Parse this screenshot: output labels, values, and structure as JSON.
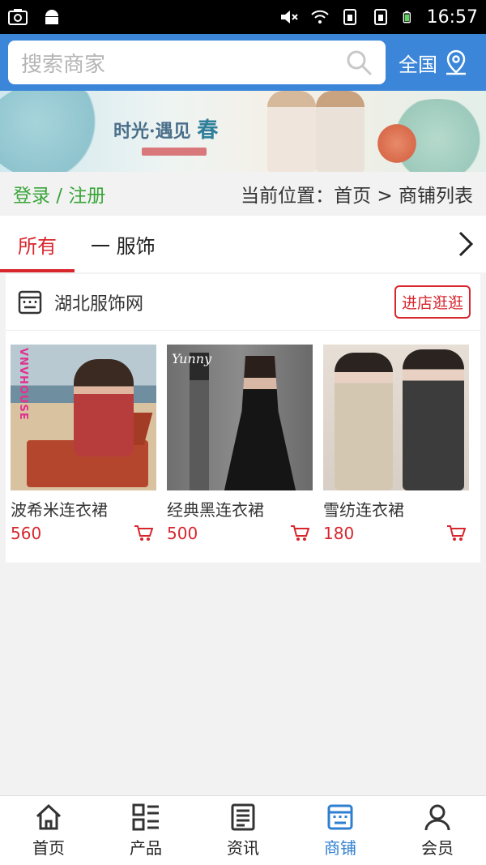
{
  "status_bar": {
    "time": "16:57"
  },
  "header": {
    "search_placeholder": "搜索商家",
    "region_label": "全国"
  },
  "banner": {
    "title_main": "时光·遇见",
    "title_accent": "春"
  },
  "breadcrumb": {
    "login_label": "登录 / 注册",
    "location_text": "当前位置：首页 > 商铺列表"
  },
  "tabs": [
    {
      "label": "所有",
      "active": true
    },
    {
      "label": "一 服饰",
      "active": false
    }
  ],
  "shop": {
    "name": "湖北服饰网",
    "visit_label": "进店逛逛",
    "products": [
      {
        "name": "波希米连衣裙",
        "price": "560",
        "image_text": "VNVHOUSE"
      },
      {
        "name": "经典黑连衣裙",
        "price": "500",
        "image_text": "Yunny"
      },
      {
        "name": "雪纺连衣裙",
        "price": "180"
      }
    ]
  },
  "bottom_nav": [
    {
      "label": "首页",
      "icon": "home-icon",
      "active": false
    },
    {
      "label": "产品",
      "icon": "grid-list-icon",
      "active": false
    },
    {
      "label": "资讯",
      "icon": "news-icon",
      "active": false
    },
    {
      "label": "商铺",
      "icon": "store-icon",
      "active": true
    },
    {
      "label": "会员",
      "icon": "user-icon",
      "active": false
    }
  ],
  "colors": {
    "header_blue": "#3b86d9",
    "accent_red": "#d8262d",
    "login_green": "#3aa53a",
    "nav_active_blue": "#2f7fd1"
  }
}
